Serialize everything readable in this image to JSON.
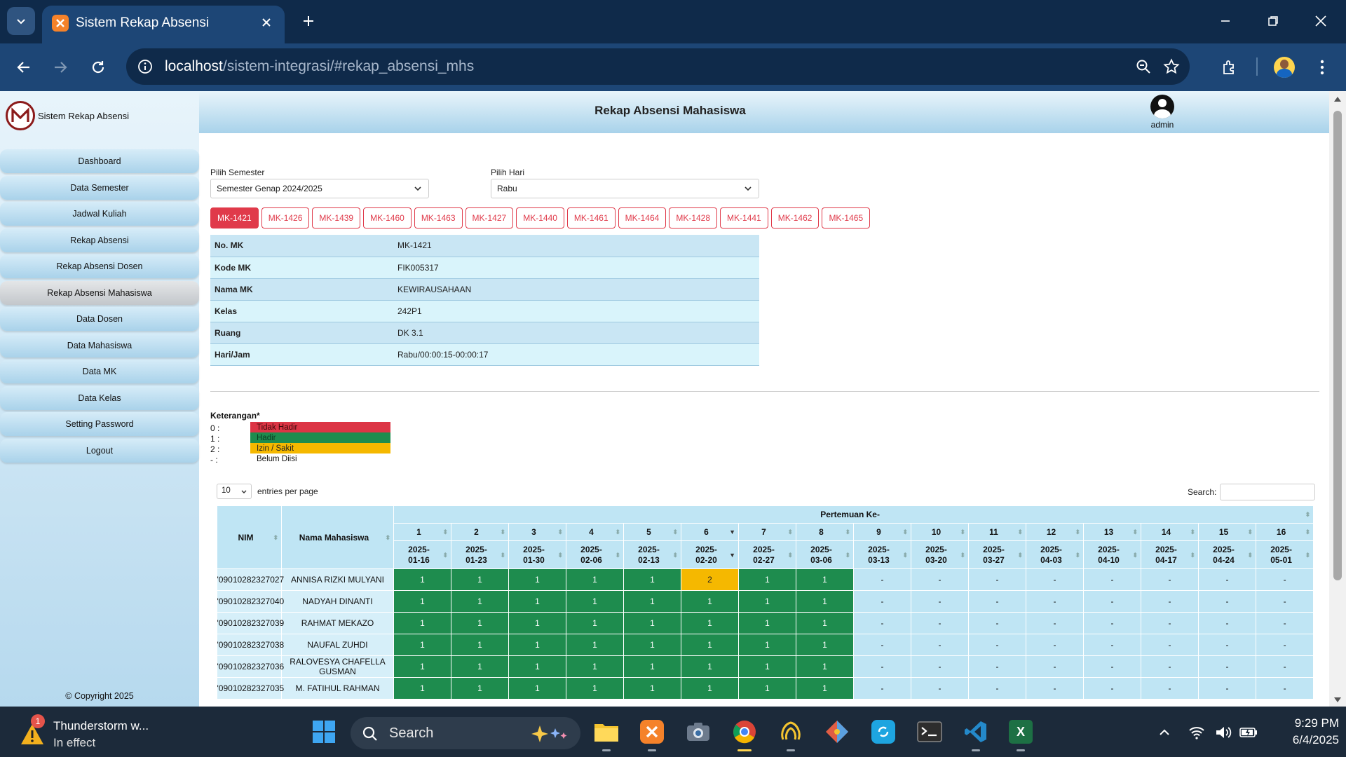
{
  "browser": {
    "tab_title": "Sistem Rekap Absensi",
    "url_host": "localhost",
    "url_path": "/sistem-integrasi/#rekap_absensi_mhs"
  },
  "sidebar": {
    "brand": "Sistem Rekap Absensi",
    "items": [
      {
        "label": "Dashboard"
      },
      {
        "label": "Data Semester"
      },
      {
        "label": "Jadwal Kuliah"
      },
      {
        "label": "Rekap Absensi"
      },
      {
        "label": "Rekap Absensi Dosen"
      },
      {
        "label": "Rekap Absensi Mahasiswa"
      },
      {
        "label": "Data Dosen"
      },
      {
        "label": "Data Mahasiswa"
      },
      {
        "label": "Data MK"
      },
      {
        "label": "Data Kelas"
      },
      {
        "label": "Setting Password"
      },
      {
        "label": "Logout"
      }
    ],
    "active_index": 5,
    "copyright": "© Copyright 2025"
  },
  "header": {
    "title": "Rekap Absensi Mahasiswa",
    "user": "admin"
  },
  "filters": {
    "semester_label": "Pilih Semester",
    "semester_value": "Semester Genap 2024/2025",
    "hari_label": "Pilih Hari",
    "hari_value": "Rabu"
  },
  "mk_tabs": [
    "MK-1421",
    "MK-1426",
    "MK-1439",
    "MK-1460",
    "MK-1463",
    "MK-1427",
    "MK-1440",
    "MK-1461",
    "MK-1464",
    "MK-1428",
    "MK-1441",
    "MK-1462",
    "MK-1465"
  ],
  "mk_active": "MK-1421",
  "mk_info": [
    {
      "key": "No. MK",
      "value": "MK-1421"
    },
    {
      "key": "Kode MK",
      "value": "FIK005317"
    },
    {
      "key": "Nama MK",
      "value": "KEWIRAUSAHAAN"
    },
    {
      "key": "Kelas",
      "value": "242P1"
    },
    {
      "key": "Ruang",
      "value": "DK 3.1"
    },
    {
      "key": "Hari/Jam",
      "value": "Rabu/00:00:15-00:00:17"
    }
  ],
  "keterangan": {
    "title": "Keterangan*",
    "items": [
      {
        "code": "0 :",
        "label": "Tidak Hadir",
        "color": "#dc3545"
      },
      {
        "code": "1 :",
        "label": "Hadir",
        "color": "#1e8c4e"
      },
      {
        "code": "2 :",
        "label": "Izin / Sakit",
        "color": "#f5b800"
      },
      {
        "code": "- :",
        "label": "Belum Diisi",
        "color": "#ffffff"
      }
    ]
  },
  "table_controls": {
    "entries_value": "10",
    "entries_label": "entries per page",
    "search_label": "Search:"
  },
  "table": {
    "col_nim": "NIM",
    "col_nama": "Nama Mahasiswa",
    "group_header": "Pertemuan Ke-",
    "meetings": [
      "1",
      "2",
      "3",
      "4",
      "5",
      "6",
      "7",
      "8",
      "9",
      "10",
      "11",
      "12",
      "13",
      "14",
      "15",
      "16"
    ],
    "dates": [
      [
        "2025-",
        "01-16"
      ],
      [
        "2025-",
        "01-23"
      ],
      [
        "2025-",
        "01-30"
      ],
      [
        "2025-",
        "02-06"
      ],
      [
        "2025-",
        "02-13"
      ],
      [
        "2025-",
        "02-20"
      ],
      [
        "2025-",
        "02-27"
      ],
      [
        "2025-",
        "03-06"
      ],
      [
        "2025-",
        "03-13"
      ],
      [
        "2025-",
        "03-20"
      ],
      [
        "2025-",
        "03-27"
      ],
      [
        "2025-",
        "04-03"
      ],
      [
        "2025-",
        "04-10"
      ],
      [
        "2025-",
        "04-17"
      ],
      [
        "2025-",
        "04-24"
      ],
      [
        "2025-",
        "05-01"
      ]
    ],
    "rows": [
      {
        "nim": "'09010282327027",
        "nama": "ANNISA RIZKI MULYANI",
        "values": [
          "1",
          "1",
          "1",
          "1",
          "1",
          "2",
          "1",
          "1",
          "-",
          "-",
          "-",
          "-",
          "-",
          "-",
          "-",
          "-"
        ]
      },
      {
        "nim": "'09010282327040",
        "nama": "NADYAH DINANTI",
        "values": [
          "1",
          "1",
          "1",
          "1",
          "1",
          "1",
          "1",
          "1",
          "-",
          "-",
          "-",
          "-",
          "-",
          "-",
          "-",
          "-"
        ]
      },
      {
        "nim": "'09010282327039",
        "nama": "RAHMAT MEKAZO",
        "values": [
          "1",
          "1",
          "1",
          "1",
          "1",
          "1",
          "1",
          "1",
          "-",
          "-",
          "-",
          "-",
          "-",
          "-",
          "-",
          "-"
        ]
      },
      {
        "nim": "'09010282327038",
        "nama": "NAUFAL ZUHDI",
        "values": [
          "1",
          "1",
          "1",
          "1",
          "1",
          "1",
          "1",
          "1",
          "-",
          "-",
          "-",
          "-",
          "-",
          "-",
          "-",
          "-"
        ]
      },
      {
        "nim": "'09010282327036",
        "nama": "RALOVESYA CHAFELLA GUSMAN",
        "values": [
          "1",
          "1",
          "1",
          "1",
          "1",
          "1",
          "1",
          "1",
          "-",
          "-",
          "-",
          "-",
          "-",
          "-",
          "-",
          "-"
        ]
      },
      {
        "nim": "'09010282327035",
        "nama": "M. FATIHUL RAHMAN",
        "values": [
          "1",
          "1",
          "1",
          "1",
          "1",
          "1",
          "1",
          "1",
          "-",
          "-",
          "-",
          "-",
          "-",
          "-",
          "-",
          "-"
        ]
      }
    ]
  },
  "taskbar": {
    "weather_title": "Thunderstorm w...",
    "weather_sub": "In effect",
    "weather_badge": "1",
    "search_label": "Search",
    "time": "9:29 PM",
    "date": "6/4/2025"
  }
}
